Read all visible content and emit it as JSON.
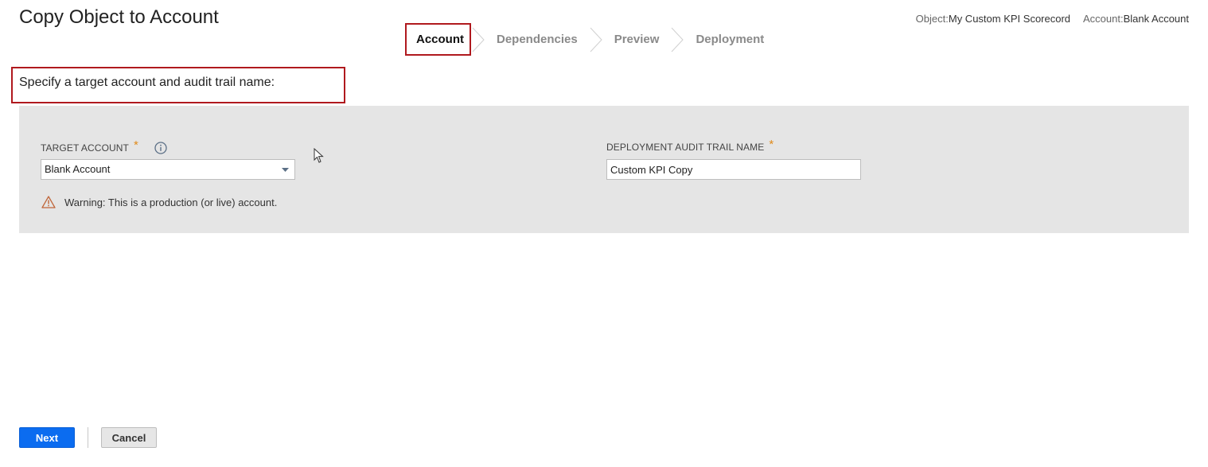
{
  "page": {
    "title": "Copy Object to Account"
  },
  "context": {
    "object_label": "Object:",
    "object_value": "My Custom KPI Scorecord",
    "account_label": "Account:",
    "account_value": "Blank Account"
  },
  "steps": [
    {
      "label": "Account",
      "active": true
    },
    {
      "label": "Dependencies",
      "active": false
    },
    {
      "label": "Preview",
      "active": false
    },
    {
      "label": "Deployment",
      "active": false
    }
  ],
  "instruction": "Specify a target account and audit trail name:",
  "form": {
    "target_account": {
      "label": "TARGET ACCOUNT",
      "required_mark": "*",
      "value": "Blank Account",
      "icon": "info-icon"
    },
    "audit_trail": {
      "label": "DEPLOYMENT AUDIT TRAIL NAME",
      "required_mark": "*",
      "value": "Custom KPI Copy"
    },
    "warning": {
      "icon": "warning-icon",
      "text": "Warning: This is a production (or live) account."
    }
  },
  "footer": {
    "next_label": "Next",
    "cancel_label": "Cancel"
  },
  "colors": {
    "highlight_border": "#b0191e",
    "primary_button": "#0b6cf0",
    "required_mark": "#e08a1a",
    "panel_bg": "#e5e5e5"
  }
}
